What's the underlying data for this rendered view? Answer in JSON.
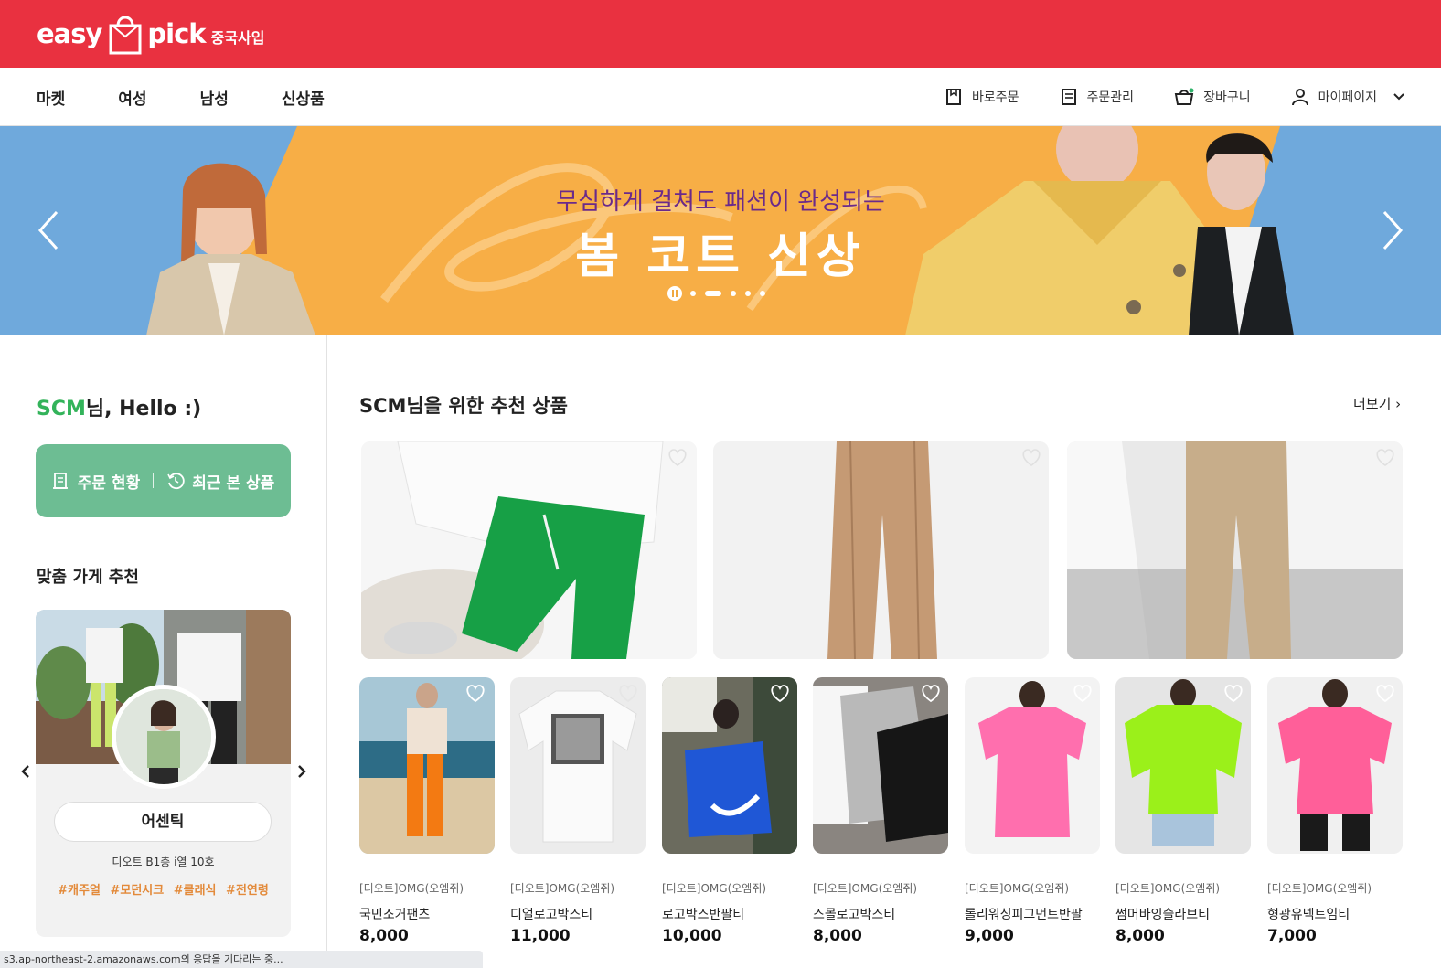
{
  "header": {
    "logo_text_left": "easy",
    "logo_text_right": "pick",
    "logo_sub": "중국사입"
  },
  "nav": {
    "main": [
      "마켓",
      "여성",
      "남성",
      "신상품"
    ],
    "util": [
      {
        "label": "바로주문",
        "icon": "quick-order-icon"
      },
      {
        "label": "주문관리",
        "icon": "order-list-icon"
      },
      {
        "label": "장바구니",
        "icon": "cart-icon"
      },
      {
        "label": "마이페이지",
        "icon": "user-icon"
      }
    ]
  },
  "banner": {
    "subtitle": "무심하게 걸쳐도 패션이 완성되는",
    "title": "봄 코트 신상",
    "active_slide": 2,
    "slide_count": 5
  },
  "left": {
    "greet_name": "SCM",
    "greet_rest": "님, Hello :)",
    "order_status": "주문 현황",
    "recent_viewed": "최근 본 상품",
    "store_section_title": "맞춤 가게 추천",
    "store": {
      "name": "어센틱",
      "address": "디오트 B1층 i열 10호",
      "tags": [
        "#캐주얼",
        "#모던시크",
        "#클래식",
        "#전연령"
      ]
    }
  },
  "recommend": {
    "title": "SCM님을 위한 추천 상품",
    "more": "더보기 ›",
    "products": [
      {
        "store": "[디오트]OMG(오엠쥐)",
        "name": "국민조거팬츠",
        "price": "8,000"
      },
      {
        "store": "[디오트]OMG(오엠쥐)",
        "name": "디얼로고박스티",
        "price": "11,000"
      },
      {
        "store": "[디오트]OMG(오엠쥐)",
        "name": "로고박스반팔티",
        "price": "10,000"
      },
      {
        "store": "[디오트]OMG(오엠쥐)",
        "name": "스몰로고박스티",
        "price": "8,000"
      },
      {
        "store": "[디오트]OMG(오엠쥐)",
        "name": "롤리워싱피그먼트반팔",
        "price": "9,000"
      },
      {
        "store": "[디오트]OMG(오엠쥐)",
        "name": "썸머바잉슬라브티",
        "price": "8,000"
      },
      {
        "store": "[디오트]OMG(오엠쥐)",
        "name": "형광유넥트임티",
        "price": "7,000"
      }
    ]
  },
  "status_bar": "s3.ap-northeast-2.amazonaws.com의 응답을 기다리는 중..."
}
